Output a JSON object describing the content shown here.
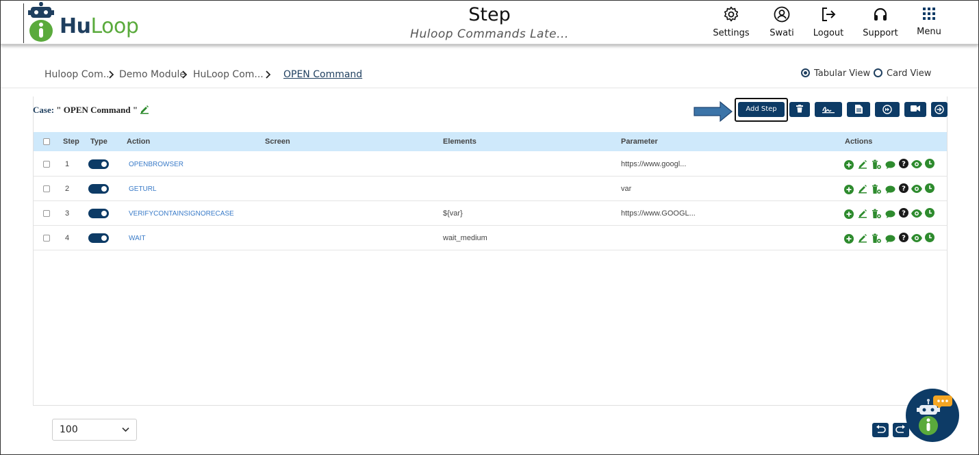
{
  "header": {
    "logo_hu": "Hu",
    "logo_loop": "Loop",
    "title": "Step",
    "subtitle": "Huloop Commands Late...",
    "nav": [
      {
        "label": "Settings",
        "icon": "gear-icon"
      },
      {
        "label": "Swati",
        "icon": "user-icon"
      },
      {
        "label": "Logout",
        "icon": "logout-icon"
      },
      {
        "label": "Support",
        "icon": "headset-icon"
      },
      {
        "label": "Menu",
        "icon": "grid-icon"
      }
    ]
  },
  "breadcrumb": {
    "items": [
      "Huloop Com...",
      "Demo Module",
      "HuLoop Com...",
      "OPEN Command"
    ]
  },
  "views": {
    "tabular": "Tabular View",
    "card": "Card View",
    "selected": "Tabular View"
  },
  "case": {
    "label": "Case:",
    "value": "\" OPEN Command \""
  },
  "toolbar": {
    "add_step": "Add Step",
    "buttons": [
      "delete-icon",
      "signature-icon",
      "document-icon",
      "fast-forward-icon",
      "video-icon",
      "arrow-right-icon"
    ]
  },
  "table": {
    "headers": {
      "step": "Step",
      "type": "Type",
      "action": "Action",
      "screen": "Screen",
      "elements": "Elements",
      "parameter": "Parameter",
      "actions": "Actions"
    },
    "rows": [
      {
        "step": "1",
        "action": "OPENBROWSER",
        "screen": "",
        "elements": "",
        "parameter": "https://www.googl..."
      },
      {
        "step": "2",
        "action": "GETURL",
        "screen": "",
        "elements": "",
        "parameter": "var"
      },
      {
        "step": "3",
        "action": "VERIFYCONTAINSIGNORECASE",
        "screen": "",
        "elements": "${var}",
        "parameter": "https://www.GOOGL..."
      },
      {
        "step": "4",
        "action": "WAIT",
        "screen": "",
        "elements": "wait_medium",
        "parameter": ""
      }
    ],
    "row_action_icons": [
      "add-icon",
      "edit-icon",
      "delete-icon",
      "comment-icon",
      "help-icon",
      "view-icon",
      "clock-icon"
    ]
  },
  "footer": {
    "page_size": "100"
  },
  "colors": {
    "primary": "#0d3b66",
    "green": "#2e8b2e",
    "header_bg": "#cfe9fb",
    "link": "#3a7bc8"
  }
}
